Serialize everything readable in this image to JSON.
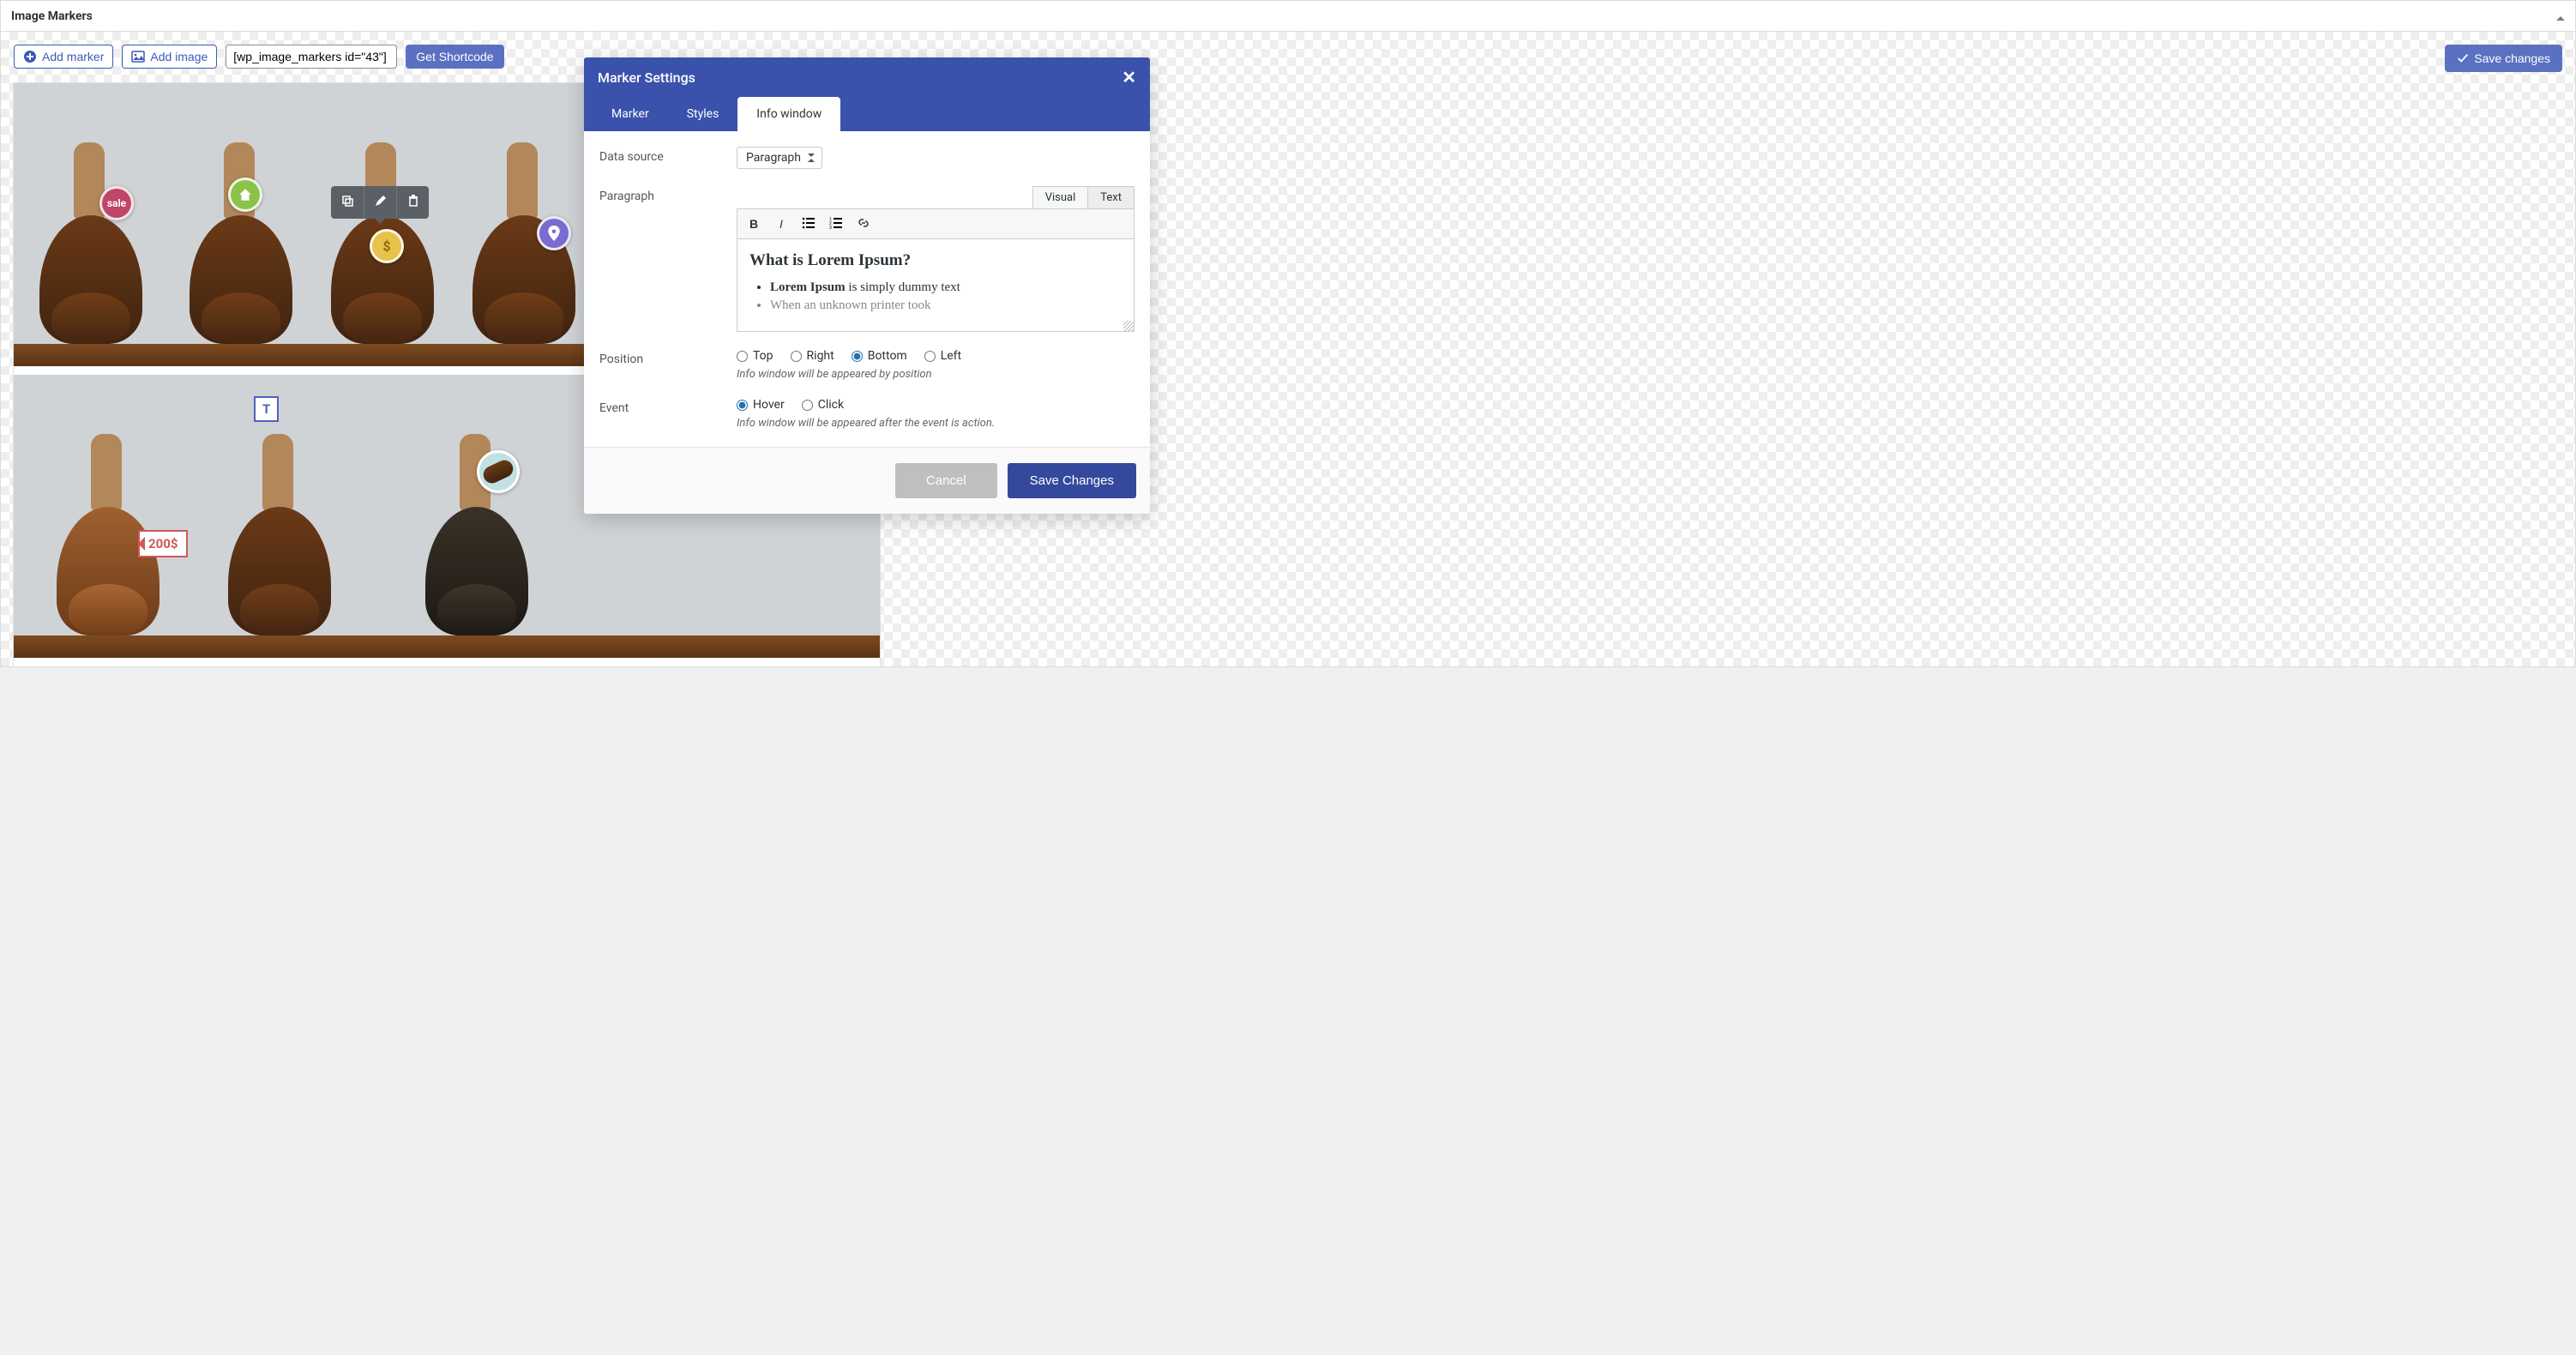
{
  "panel": {
    "title": "Image Markers"
  },
  "topbar": {
    "add_marker": "Add marker",
    "add_image": "Add image",
    "shortcode_value": "[wp_image_markers id=\"43\"]",
    "get_shortcode": "Get Shortcode",
    "save_changes": "Save changes"
  },
  "markers": {
    "sale": "sale",
    "text": "T",
    "price": "200$"
  },
  "settings": {
    "title": "Marker Settings",
    "tabs": {
      "marker": "Marker",
      "styles": "Styles",
      "info_window": "Info window"
    },
    "data_source": {
      "label": "Data source",
      "value": "Paragraph"
    },
    "paragraph": {
      "label": "Paragraph",
      "editor_tabs": {
        "visual": "Visual",
        "text": "Text"
      },
      "heading": "What is Lorem Ipsum?",
      "bullets": [
        {
          "bold": "Lorem Ipsum",
          "rest": " is simply dummy text"
        },
        {
          "bold": "",
          "rest": "When an unknown printer took"
        }
      ]
    },
    "position": {
      "label": "Position",
      "options": {
        "top": "Top",
        "right": "Right",
        "bottom": "Bottom",
        "left": "Left"
      },
      "hint": "Info window will be appeared by position"
    },
    "event": {
      "label": "Event",
      "options": {
        "hover": "Hover",
        "click": "Click"
      },
      "hint": "Info window will be appeared after the event is action."
    },
    "footer": {
      "cancel": "Cancel",
      "save": "Save Changes"
    }
  }
}
